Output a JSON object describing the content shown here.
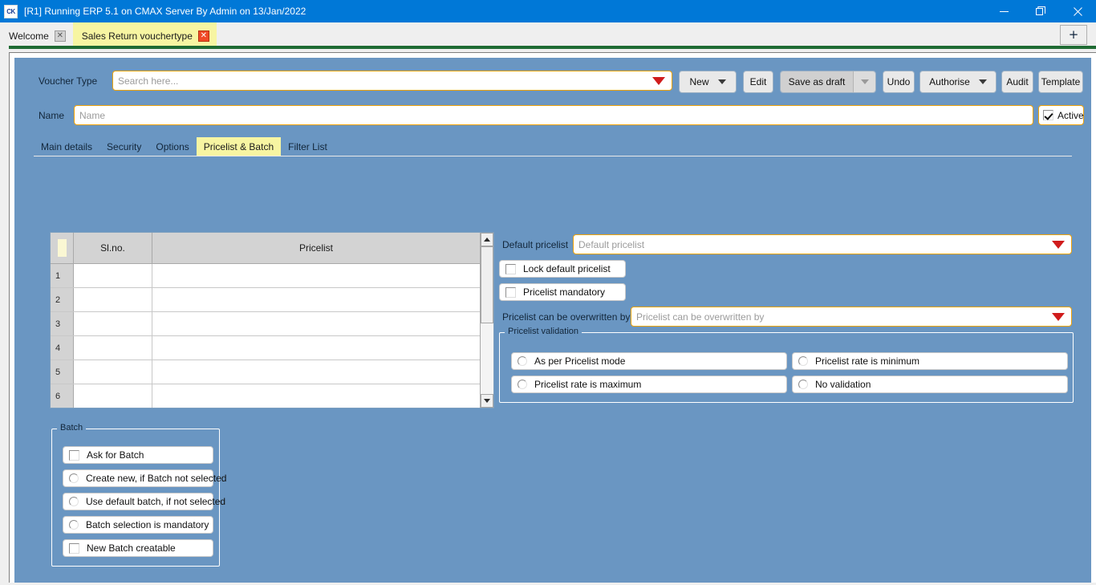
{
  "window": {
    "title": "[R1] Running ERP 5.1 on CMAX Server By Admin on 13/Jan/2022",
    "app_icon_text": "CK",
    "minimize_icon": "minimize-icon",
    "restore_icon": "restore-icon",
    "close_icon": "close-icon"
  },
  "doc_tabs": {
    "items": [
      {
        "label": "Welcome",
        "close_label": "✕",
        "active": false
      },
      {
        "label": "Sales Return vouchertype",
        "close_label": "✕",
        "active": true
      }
    ],
    "new_tab_label": "+"
  },
  "header": {
    "voucher_type_label": "Voucher Type",
    "voucher_type_placeholder": "Search here...",
    "name_label": "Name",
    "name_placeholder": "Name",
    "active_label": "Active",
    "active_checked": true
  },
  "toolbar": {
    "new_label": "New",
    "edit_label": "Edit",
    "save_as_draft_label": "Save as draft",
    "undo_label": "Undo",
    "authorise_label": "Authorise",
    "audit_label": "Audit",
    "template_label": "Template"
  },
  "section_tabs": {
    "items": [
      {
        "label": "Main details",
        "active": false
      },
      {
        "label": "Security",
        "active": false
      },
      {
        "label": "Options",
        "active": false
      },
      {
        "label": "Pricelist & Batch",
        "active": true
      },
      {
        "label": "Filter List",
        "active": false
      }
    ]
  },
  "grid": {
    "columns": [
      "Sl.no.",
      "Pricelist"
    ],
    "rows": [
      {
        "num": "1",
        "slno": "",
        "pricelist": ""
      },
      {
        "num": "2",
        "slno": "",
        "pricelist": ""
      },
      {
        "num": "3",
        "slno": "",
        "pricelist": ""
      },
      {
        "num": "4",
        "slno": "",
        "pricelist": ""
      },
      {
        "num": "5",
        "slno": "",
        "pricelist": ""
      },
      {
        "num": "6",
        "slno": "",
        "pricelist": ""
      }
    ]
  },
  "pricelist_panel": {
    "default_pricelist_label": "Default pricelist",
    "default_pricelist_placeholder": "Default pricelist",
    "lock_default_label": "Lock default pricelist",
    "lock_default_checked": false,
    "pricelist_mandatory_label": "Pricelist  mandatory",
    "pricelist_mandatory_checked": false,
    "overwritten_by_label": "Pricelist can be overwritten by",
    "overwritten_by_placeholder": "Pricelist can be overwritten by"
  },
  "pricelist_validation": {
    "legend": "Pricelist validation",
    "options": [
      {
        "label": "As per Pricelist mode",
        "selected": false
      },
      {
        "label": "Pricelist rate is minimum",
        "selected": false
      },
      {
        "label": "Pricelist rate is maximum",
        "selected": false
      },
      {
        "label": "No validation",
        "selected": false
      }
    ]
  },
  "batch": {
    "legend": "Batch",
    "options": [
      {
        "label": "Ask for Batch",
        "type": "checkbox",
        "checked": false
      },
      {
        "label": "Create new, if Batch not selected",
        "type": "radio",
        "selected": false
      },
      {
        "label": "Use default batch, if not selected",
        "type": "radio",
        "selected": false
      },
      {
        "label": "Batch selection is mandatory",
        "type": "radio",
        "selected": false
      },
      {
        "label": "New Batch creatable",
        "type": "checkbox",
        "checked": false
      }
    ]
  },
  "colors": {
    "titlebar": "#0078d7",
    "canvas": "#6a96c2",
    "active_tab": "#f7f5a2",
    "field_border": "#f0a30a",
    "dropdown_arrow": "#d01c1c",
    "green_bar": "#1f6b33"
  }
}
